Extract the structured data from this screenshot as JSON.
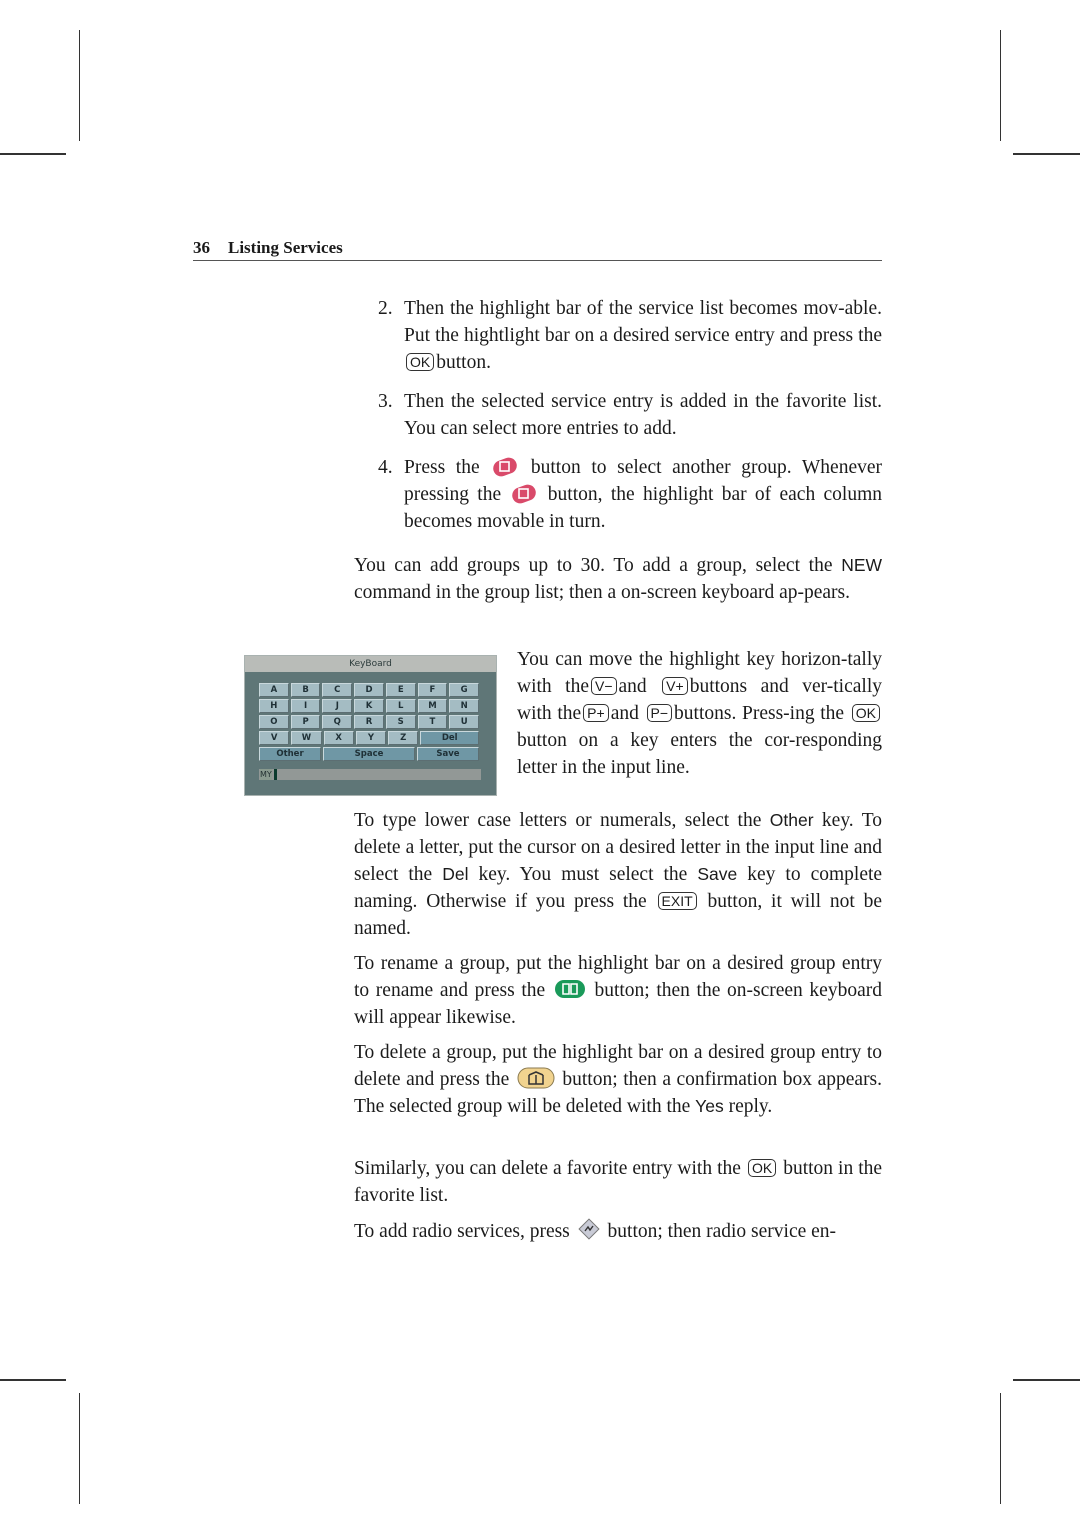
{
  "header": {
    "page_number": "36",
    "section_title": "Listing Services"
  },
  "steps": [
    {
      "num": "2.",
      "parts": [
        "Then the highlight bar of the service list becomes mov-able. Put the hightlight bar on a desired service entry and press the",
        "OK",
        "button."
      ]
    },
    {
      "num": "3.",
      "text": "Then the selected service entry is added in the favorite list. You can select more entries to add."
    },
    {
      "num": "4.",
      "parts": [
        "Press the",
        "button to select another group. Whenever pressing the",
        "button, the highlight bar of each column becomes movable in turn."
      ],
      "icon": "red-swap-button-icon"
    }
  ],
  "para_groups": {
    "t1": "You can add groups up to 30. To add a group, select the",
    "cmd": "NEW",
    "t2": "command in the group list; then a on-screen keyboard ap-pears."
  },
  "para_move": {
    "t1": "You can move the highlight key horizon-tally with the",
    "k1": "V−",
    "t2": "and",
    "k2": "V+",
    "t3": "buttons and ver-tically with the",
    "k3": "P+",
    "t4": "and",
    "k4": "P−",
    "t5": "buttons. Press-ing the",
    "k5": "OK",
    "t6": "button on a key enters the cor-responding letter in the input line."
  },
  "para_lower": {
    "t1": "To type lower case letters or numerals, select the",
    "other": "Other",
    "t2": "key. To delete a letter, put the cursor on a desired letter in the input line and select the",
    "del": "Del",
    "t3": "key. You must select the",
    "save": "Save",
    "t4": "key to complete naming. Otherwise if you press the",
    "exit": "EXIT",
    "t5": "button, it will not be named."
  },
  "para_rename": {
    "t1": "To rename a group, put the highlight bar on a desired group entry to rename and press the",
    "t2": "button; then the on-screen keyboard will appear likewise."
  },
  "para_delete": {
    "t1": "To delete a group, put the highlight bar on a desired group entry to delete and press the",
    "t2": "button; then a confirmation box appears. The selected group will be deleted with the",
    "yes": "Yes",
    "t3": "reply."
  },
  "para_fav": {
    "t1": "Similarly, you can delete a favorite entry with the",
    "ok": "OK",
    "t2": "button in the favorite list."
  },
  "para_radio": {
    "t1": "To add radio services, press",
    "t2": "button; then radio service en-"
  },
  "keyboard": {
    "title": "KeyBoard",
    "rows": [
      [
        "A",
        "B",
        "C",
        "D",
        "E",
        "F",
        "G"
      ],
      [
        "H",
        "I",
        "J",
        "K",
        "L",
        "M",
        "N"
      ],
      [
        "O",
        "P",
        "Q",
        "R",
        "S",
        "T",
        "U"
      ],
      [
        "V",
        "W",
        "X",
        "Y",
        "Z",
        "Del"
      ],
      [
        "Other",
        "Space",
        "Save"
      ]
    ],
    "input_value": "MY"
  },
  "colors": {
    "red_button": "#d94a6a",
    "green_button": "#1a9a5a",
    "yellow_button": "#f1d38f",
    "keyboard_bg": "#5f7677"
  }
}
